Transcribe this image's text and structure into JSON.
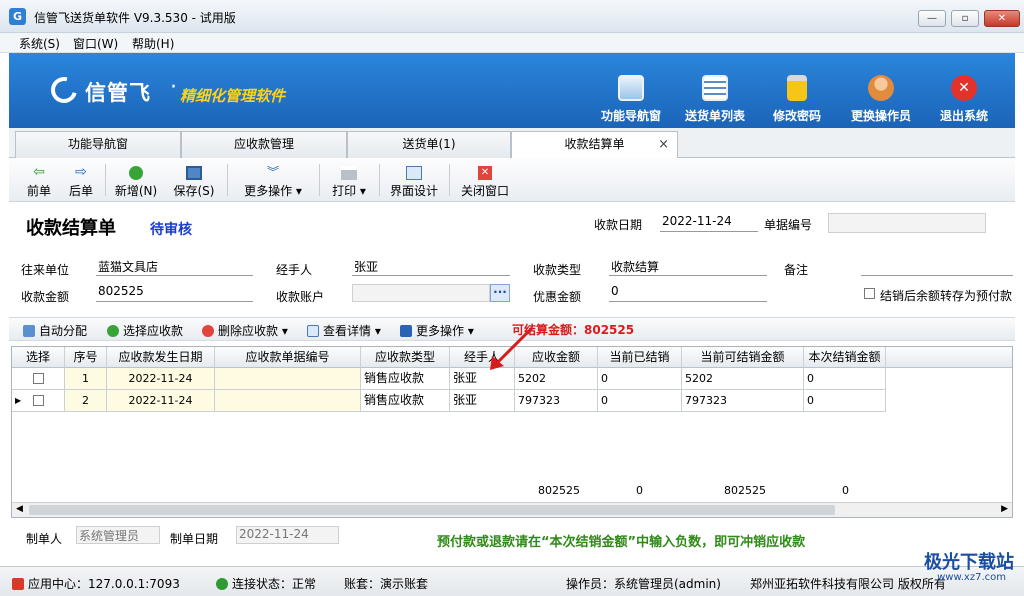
{
  "window": {
    "title": "信管飞送货单软件 V9.3.530 - 试用版",
    "icon_glyph": "G"
  },
  "menu": [
    "系统(S)",
    "窗口(W)",
    "帮助(H)"
  ],
  "banner": {
    "logo_name": "信管飞",
    "logo_dot": "·",
    "slogan": "精细化管理软件",
    "buttons": [
      {
        "label": "功能导航窗",
        "icon": "monitor-icon"
      },
      {
        "label": "送货单列表",
        "icon": "list-icon"
      },
      {
        "label": "修改密码",
        "icon": "lock-icon"
      },
      {
        "label": "更换操作员",
        "icon": "user-icon"
      },
      {
        "label": "退出系统",
        "icon": "exit-icon"
      }
    ]
  },
  "tabs": [
    "功能导航窗",
    "应收款管理",
    "送货单(1)",
    "收款结算单"
  ],
  "tab_close": "×",
  "toolbar": [
    "前单",
    "后单",
    "新增(N)",
    "保存(S)",
    "更多操作",
    "打印",
    "界面设计",
    "关闭窗口"
  ],
  "form": {
    "title": "收款结算单",
    "status": "待审核",
    "date_label": "收款日期",
    "date": "2022-11-24",
    "docno_label": "单据编号",
    "docno": "",
    "partner_label": "往来单位",
    "partner": "蓝猫文具店",
    "handler_label": "经手人",
    "handler": "张亚",
    "type_label": "收款类型",
    "type": "收款结算",
    "note_label": "备注",
    "note": "",
    "amount_label": "收款金额",
    "amount": "802525",
    "account_label": "收款账户",
    "account": "",
    "account_btn": "···",
    "discount_label": "优惠金额",
    "discount": "0",
    "prepay_label": "结销后余额转存为预付款"
  },
  "grid_toolbar": [
    "自动分配",
    "选择应收款",
    "删除应收款",
    "查看详情",
    "更多操作"
  ],
  "available": "可结算金额：802525",
  "grid": {
    "headers": [
      "选择",
      "序号",
      "应收款发生日期",
      "应收款单据编号",
      "应收款类型",
      "经手人",
      "应收金额",
      "当前已结销",
      "当前可结销金额",
      "本次结销金额"
    ],
    "rows": [
      {
        "seq": "1",
        "date": "2022-11-24",
        "docno": "",
        "type": "销售应收款",
        "handler": "张亚",
        "amount": "5202",
        "settled": "0",
        "available": "5202",
        "current": "0"
      },
      {
        "seq": "2",
        "date": "2022-11-24",
        "docno": "",
        "type": "销售应收款",
        "handler": "张亚",
        "amount": "797323",
        "settled": "0",
        "available": "797323",
        "current": "0"
      }
    ],
    "totals": {
      "amount": "802525",
      "settled": "0",
      "available": "802525",
      "current": "0"
    }
  },
  "footer": {
    "maker_label": "制单人",
    "maker": "系统管理员",
    "make_date_label": "制单日期",
    "make_date": "2022-11-24",
    "note": "预付款或退款请在“本次结销金额”中输入负数，即可冲销应收款"
  },
  "status": {
    "app_center": "应用中心：127.0.0.1:7093",
    "conn": "连接状态：正常",
    "book": "账套：演示账套",
    "operator": "操作员：系统管理员(admin)",
    "company": "郑州亚拓软件科技有限公司 版权所有"
  },
  "watermark": {
    "text": "极光下载站",
    "url": "www.xz7.com"
  },
  "colors": {
    "banner": "#1f72c9",
    "slogan": "#ffd21a",
    "status_pending": "#1a3cc8",
    "available": "#d81c1c",
    "note": "#2f8a18"
  }
}
